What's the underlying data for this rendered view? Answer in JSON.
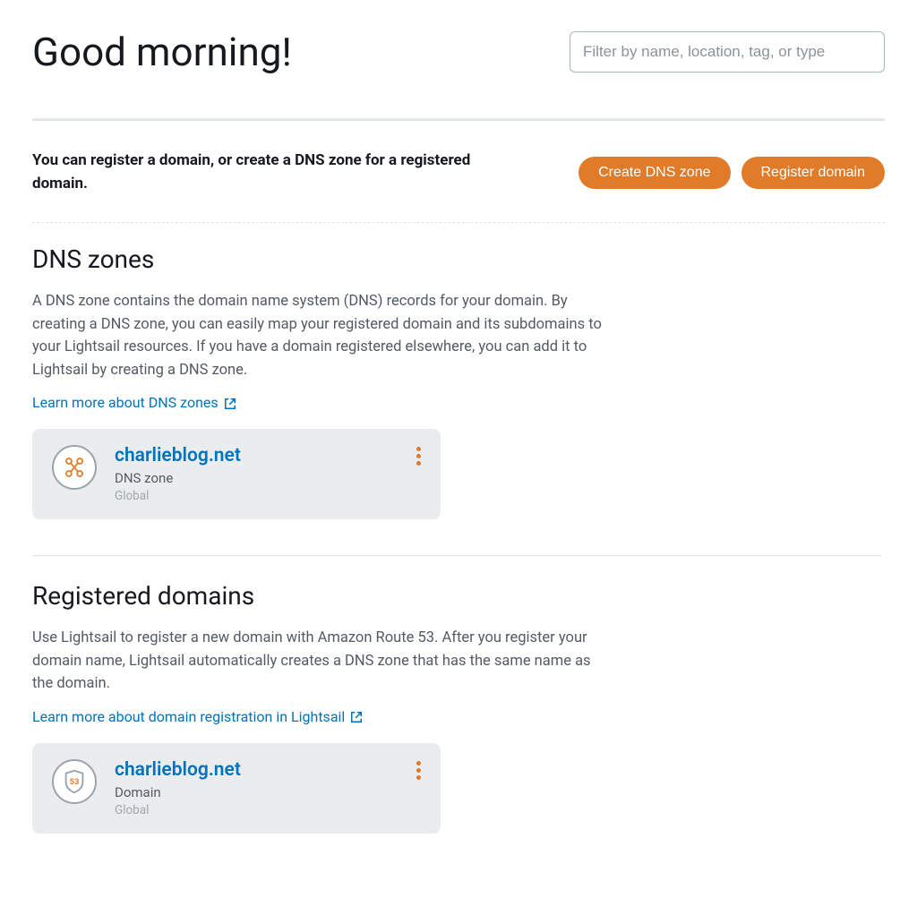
{
  "header": {
    "greeting": "Good morning!",
    "filter_placeholder": "Filter by name, location, tag, or type"
  },
  "prompt": {
    "text": "You can register a domain, or create a DNS zone for a registered domain.",
    "create_dns_label": "Create DNS zone",
    "register_domain_label": "Register domain"
  },
  "dns_section": {
    "title": "DNS zones",
    "description": "A DNS zone contains the domain name system (DNS) records for your domain. By creating a DNS zone, you can easily map your registered domain and its subdomains to your Lightsail resources. If you have a domain registered elsewhere, you can add it to Lightsail by creating a DNS zone.",
    "learn_more": "Learn more about DNS zones",
    "card": {
      "name": "charlieblog.net",
      "type": "DNS zone",
      "scope": "Global"
    }
  },
  "domains_section": {
    "title": "Registered domains",
    "description": "Use Lightsail to register a new domain with Amazon Route 53. After you register your domain name, Lightsail automatically creates a DNS zone that has the same name as the domain.",
    "learn_more": "Learn more about domain registration in Lightsail",
    "card": {
      "name": "charlieblog.net",
      "type": "Domain",
      "scope": "Global",
      "badge_number": "53"
    }
  }
}
